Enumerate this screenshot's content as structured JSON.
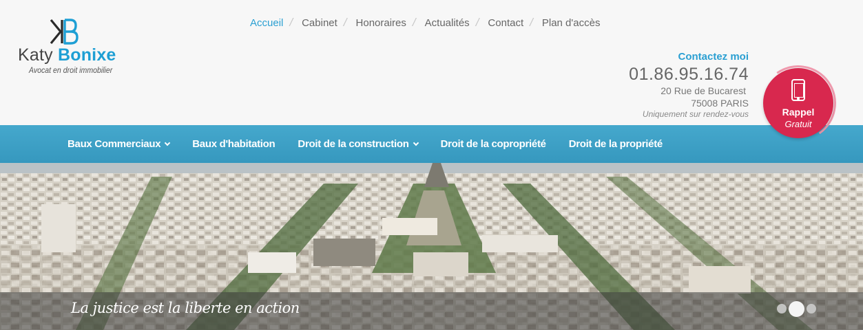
{
  "logo": {
    "first_name": "Katy",
    "last_name": "Bonixe",
    "tagline": "Avocat en droit immobilier",
    "monogram": "KB"
  },
  "top_nav": {
    "items": [
      {
        "label": "Accueil",
        "active": true
      },
      {
        "label": "Cabinet",
        "active": false
      },
      {
        "label": "Honoraires",
        "active": false
      },
      {
        "label": "Actualités",
        "active": false
      },
      {
        "label": "Contact",
        "active": false
      },
      {
        "label": "Plan d'accès",
        "active": false
      }
    ]
  },
  "contact": {
    "title": "Contactez moi",
    "phone": "01.86.95.16.74",
    "street": "20 Rue de Bucarest",
    "city": "75008 PARIS",
    "note": "Uniquement sur rendez-vous"
  },
  "callback": {
    "label": "Rappel",
    "sub": "Gratuit",
    "icon": "smartphone-icon"
  },
  "main_nav": {
    "items": [
      {
        "label": "Baux Commerciaux",
        "has_dropdown": true
      },
      {
        "label": "Baux d'habitation",
        "has_dropdown": false
      },
      {
        "label": "Droit de la construction",
        "has_dropdown": true
      },
      {
        "label": "Droit de la copropriété",
        "has_dropdown": false
      },
      {
        "label": "Droit de la propriété",
        "has_dropdown": false
      }
    ]
  },
  "hero": {
    "caption": "La justice est la liberte en action",
    "slides_count": 3,
    "active_slide": 2
  },
  "colors": {
    "accent_blue": "#2a9fd2",
    "nav_bar": "#3a9ec5",
    "callback_red": "#d8284e"
  }
}
